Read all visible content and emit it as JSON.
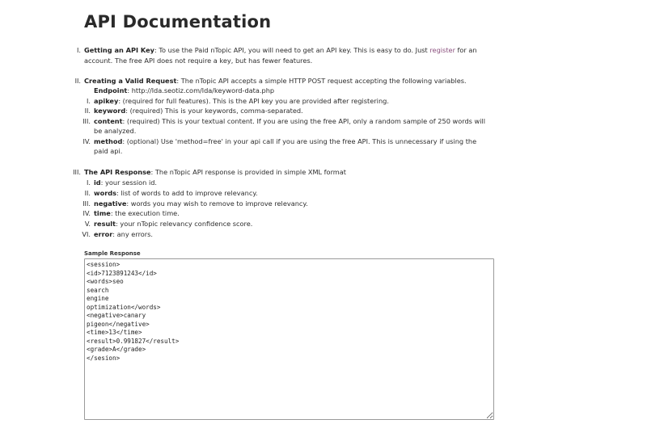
{
  "page_title": "API Documentation",
  "sections": [
    {
      "numeral": "I.",
      "heading": "Getting an API Key",
      "text_before_link": ": To use the Paid nTopic API, you will need to get an API key. This is easy to do. Just ",
      "link_label": "register",
      "text_after_link": " for an",
      "line2": "account. The free API does not require a key, but has fewer features."
    },
    {
      "numeral": "II.",
      "heading": "Creating a Valid Request",
      "text": ": The nTopic API accepts a simple HTTP POST request accepting the following variables.",
      "endpoint_label": "Endpoint",
      "endpoint_value": ": http://lda.seotiz.com/lda/keyword-data.php",
      "items": [
        {
          "numeral": "I.",
          "name": "apikey",
          "desc": ": (required for full features). This is the API key you are provided after registering."
        },
        {
          "numeral": "II.",
          "name": "keyword",
          "desc": ": (required) This is your keywords, comma-separated."
        },
        {
          "numeral": "III.",
          "name": "content",
          "desc": ": (required) This is your textual content. If you are using the free API, only a random sample of 250 words will",
          "desc2": "be analyzed."
        },
        {
          "numeral": "IV.",
          "name": "method",
          "desc": ": (optional) Use 'method=free' in your api call if you are using the free API. This is unnecessary if using the",
          "desc2": "paid api."
        }
      ]
    },
    {
      "numeral": "III.",
      "heading": "The API Response",
      "text": ": The nTopic API response is provided in simple XML format",
      "items": [
        {
          "numeral": "I.",
          "name": "id",
          "desc": ": your session id."
        },
        {
          "numeral": "II.",
          "name": "words",
          "desc": ": list of words to add to improve relevancy."
        },
        {
          "numeral": "III.",
          "name": "negative",
          "desc": ": words you may wish to remove to improve relevancy."
        },
        {
          "numeral": "IV.",
          "name": "time",
          "desc": ": the execution time."
        },
        {
          "numeral": "V.",
          "name": "result",
          "desc": ": your nTopic relevancy confidence score."
        },
        {
          "numeral": "VI.",
          "name": "error",
          "desc": ": any errors."
        }
      ]
    }
  ],
  "sample": {
    "label": "Sample Response",
    "content": "<session>\n<id>7123891243</id>\n<words>seo\nsearch\nengine\noptimization</words>\n<negative>canary\npigeon</negative>\n<time>13</time>\n<result>0.991827</result>\n<grade>A</grade>\n</sesion>"
  },
  "colors": {
    "link": "#8a4f7d",
    "text": "#2d2d2d",
    "border": "#9a9a9a"
  }
}
